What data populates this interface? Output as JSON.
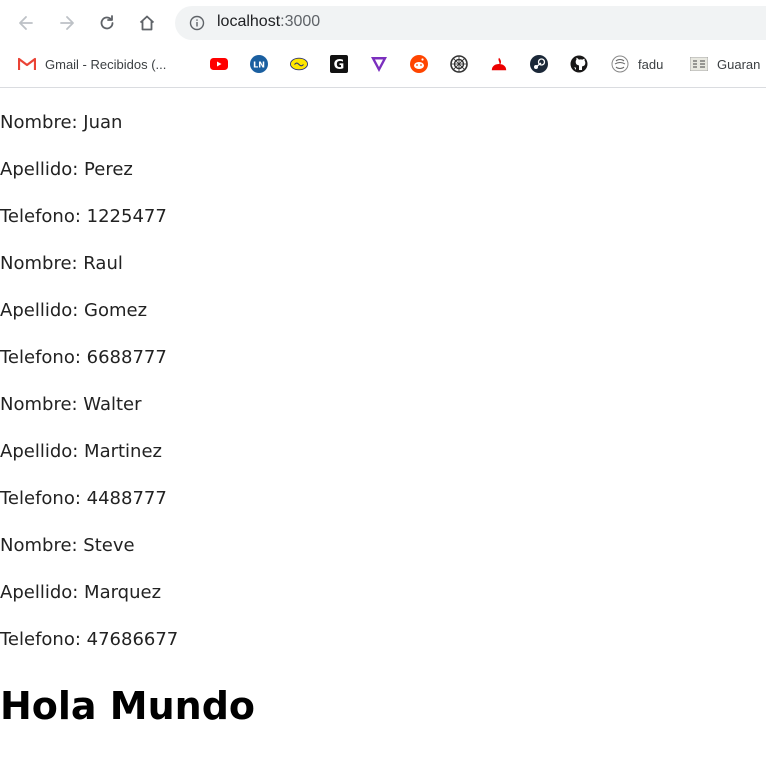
{
  "browser": {
    "url_host": "localhost",
    "url_port": ":3000",
    "bookmarks": [
      {
        "icon": "gmail-icon",
        "label": "Gmail - Recibidos (..."
      },
      {
        "icon": "youtube-icon",
        "label": ""
      },
      {
        "icon": "ln-icon",
        "label": ""
      },
      {
        "icon": "ml-icon",
        "label": ""
      },
      {
        "icon": "g-icon",
        "label": ""
      },
      {
        "icon": "v-icon",
        "label": ""
      },
      {
        "icon": "reddit-icon",
        "label": ""
      },
      {
        "icon": "wheel-icon",
        "label": ""
      },
      {
        "icon": "santander-icon",
        "label": ""
      },
      {
        "icon": "steam-icon",
        "label": ""
      },
      {
        "icon": "github-icon",
        "label": ""
      },
      {
        "icon": "fadu-icon",
        "label": "fadu"
      },
      {
        "icon": "guarani-icon",
        "label": "Guaran"
      }
    ]
  },
  "page": {
    "lines": [
      "Nombre: Juan",
      "Apellido: Perez",
      "Telefono: 1225477",
      "Nombre: Raul",
      "Apellido: Gomez",
      "Telefono: 6688777",
      "Nombre: Walter",
      "Apellido: Martinez",
      "Telefono: 4488777",
      "Nombre: Steve",
      "Apellido: Marquez",
      "Telefono: 47686677"
    ],
    "heading": "Hola Mundo"
  },
  "colors": {
    "youtube": "#ff0000",
    "ln": "#1a5fa0",
    "reddit": "#ff4500",
    "santander": "#ec0000",
    "steam": "#1b2838",
    "v": "#7b2fbe"
  }
}
